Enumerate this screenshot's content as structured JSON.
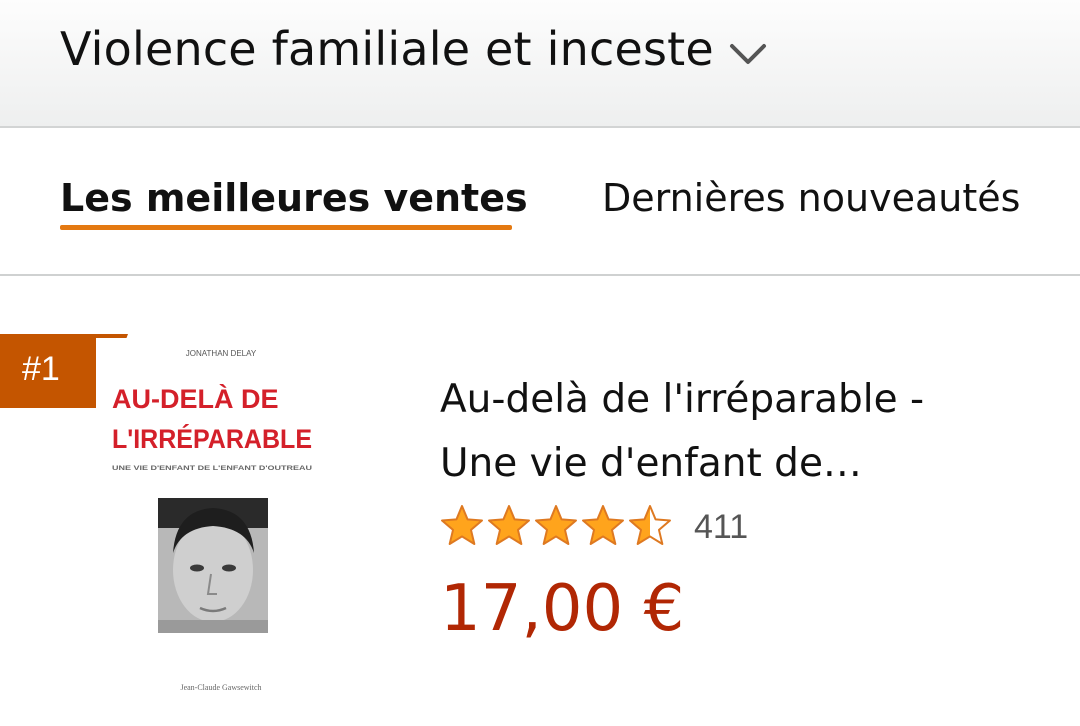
{
  "header": {
    "category_title": "Violence familiale et inceste",
    "dropdown_icon": "chevron-down-icon"
  },
  "tabs": [
    {
      "label": "Les meilleures ventes",
      "active": true
    },
    {
      "label": "Dernières nouveautés",
      "active": false
    }
  ],
  "product": {
    "rank": "#1",
    "cover": {
      "author": "JONATHAN DELAY",
      "title_line1": "AU-DELÀ DE",
      "title_line2": "L'IRRÉPARABLE",
      "subtitle": "UNE VIE D'ENFANT DE L'ENFANT D'OUTREAU",
      "publisher": "Jean-Claude Gawsewitch"
    },
    "title_line1": "Au-delà de l'irréparable -",
    "title_line2": "Une vie d'enfant de…",
    "rating": 4.5,
    "rating_max": 5,
    "review_count": "411",
    "price": "17,00 €"
  },
  "colors": {
    "accent_orange": "#e47911",
    "rank_badge": "#c45500",
    "price": "#b12704",
    "star_fill": "#ffa41c",
    "star_stroke": "#de7921",
    "cover_title_red": "#d4202a"
  }
}
